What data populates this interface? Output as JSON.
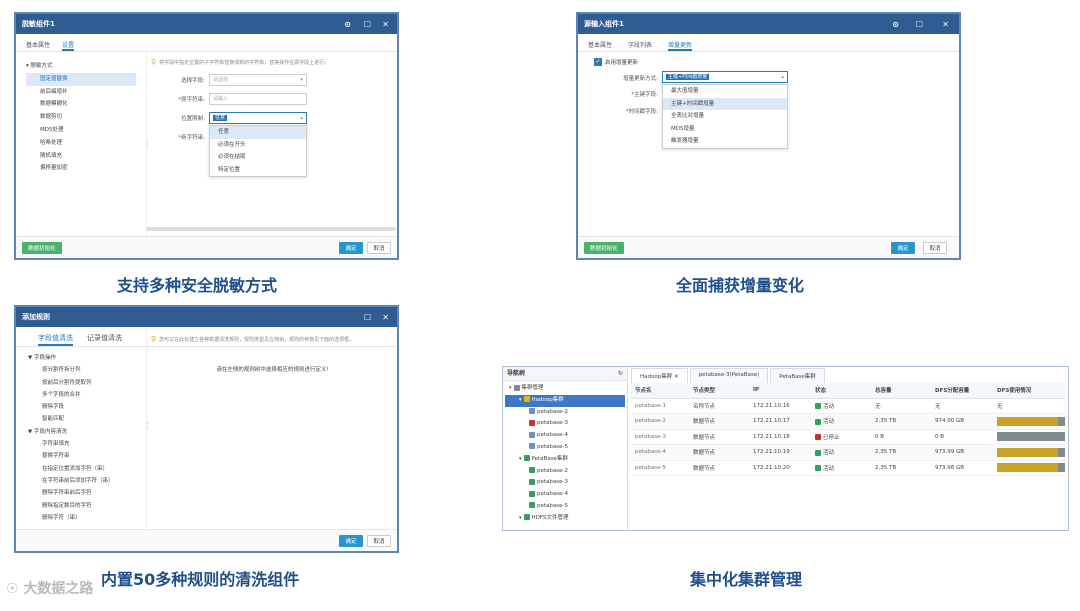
{
  "panel1": {
    "title": "脱敏组件1",
    "tabs": [
      "基本属性",
      "设置"
    ],
    "active_tab": 1,
    "tree_root": "脱敏方式",
    "tree_items": [
      "固定值替换",
      "前后缀增补",
      "数据模糊化",
      "数据剪切",
      "MD5处理",
      "哈希处理",
      "随机填充",
      "偏移量加密"
    ],
    "selected_index": 0,
    "tip": "将字段中指定位置的子字符串替换成新的字符串，替换操作在源字段上进行。",
    "fields": [
      {
        "label": "选择字段:",
        "placeholder": "请选择"
      },
      {
        "label": "*原字符串:",
        "placeholder": "请输入"
      },
      {
        "label": "位置限制:",
        "value": "任意"
      },
      {
        "label": "*新字符串:",
        "placeholder": ""
      }
    ],
    "dropdown": [
      "任意",
      "必须在开头",
      "必须在结尾",
      "特定位置"
    ],
    "green_btn": "数据初始化",
    "ok": "确定",
    "cancel": "取消"
  },
  "panel2": {
    "title": "源输入组件1",
    "tabs": [
      "基本属性",
      "字段列表",
      "增量更新"
    ],
    "active_tab": 2,
    "checkbox_label": "启用增量更新",
    "mode_label": "增量更新方式:",
    "mode_value": "主键+时间戳增量",
    "pk_label": "*主键字段:",
    "ts_label": "*时间戳字段:",
    "dropdown": [
      "最大值增量",
      "主键+时间戳增量",
      "全表比对增量",
      "MD5增量",
      "触发器增量"
    ],
    "dropdown_hl": 1,
    "green_btn": "数据初始化",
    "ok": "确定",
    "cancel": "取消"
  },
  "panel3": {
    "title": "添加规则",
    "tabs": [
      "字段值清洗",
      "记录值清洗"
    ],
    "active_tab": 0,
    "tip": "您可以在此处建立各种数据清洗规则，规则类型见左侧树，规则的参数见下面的选项框。",
    "center_msg": "请在左侧的规则树中选择相应的规则进行定义!",
    "tree": [
      {
        "text": "▼ 字段操作",
        "indent": 0
      },
      {
        "text": "按分割符拆分列",
        "indent": 1
      },
      {
        "text": "按前后分割符提取列",
        "indent": 1
      },
      {
        "text": "多个字段的合并",
        "indent": 1
      },
      {
        "text": "删除字段",
        "indent": 1
      },
      {
        "text": "智能匹配",
        "indent": 1
      },
      {
        "text": "▼ 字段内容清洗",
        "indent": 0
      },
      {
        "text": "字符串填充",
        "indent": 1
      },
      {
        "text": "替换字符串",
        "indent": 1
      },
      {
        "text": "在指定位置添加字符（串）",
        "indent": 1
      },
      {
        "text": "在字符串前后添加字符（串）",
        "indent": 1
      },
      {
        "text": "删除字符串前后字符",
        "indent": 1
      },
      {
        "text": "删除指定数目的字符",
        "indent": 1
      },
      {
        "text": "删除字符（串）",
        "indent": 1
      }
    ],
    "ok": "确定",
    "cancel": "取消"
  },
  "panel4": {
    "nav_title": "导航树",
    "tree": [
      {
        "text": "集群管理",
        "indent": 0,
        "icon": "cluster-icon"
      },
      {
        "text": "Hadoop集群",
        "indent": 1,
        "icon": "hadoop-icon",
        "selected": true
      },
      {
        "text": "petabase-2",
        "indent": 2,
        "icon": "node-icon"
      },
      {
        "text": "petabase-3",
        "indent": 2,
        "icon": "node-stop-icon"
      },
      {
        "text": "petabase-4",
        "indent": 2,
        "icon": "node-icon"
      },
      {
        "text": "petabase-5",
        "indent": 2,
        "icon": "node-icon"
      },
      {
        "text": "PetaBase集群",
        "indent": 1,
        "icon": "petabase-icon"
      },
      {
        "text": "petabase-2",
        "indent": 2,
        "icon": "node-green-icon"
      },
      {
        "text": "petabase-3",
        "indent": 2,
        "icon": "node-green-icon"
      },
      {
        "text": "petabase-4",
        "indent": 2,
        "icon": "node-green-icon"
      },
      {
        "text": "petabase-5",
        "indent": 2,
        "icon": "node-green-icon"
      },
      {
        "text": "HDFS文件管理",
        "indent": 1,
        "icon": "hdfs-icon"
      }
    ],
    "tabs": [
      "Hadoop集群 ✕",
      "petabase-3(PetaBase)",
      "PetaBase集群"
    ],
    "columns": [
      "节点名",
      "节点类型",
      "IP",
      "状态",
      "总容量",
      "DFS分配容量",
      "DFS使用情况"
    ],
    "rows": [
      {
        "name": "petabase-1",
        "type": "名称节点",
        "ip": "172.21.10.16",
        "status": "活动",
        "total": "无",
        "dfs": "无",
        "usage_text": "无",
        "usage": null
      },
      {
        "name": "petabase-2",
        "type": "数据节点",
        "ip": "172.21.10.17",
        "status": "活动",
        "total": "2.35 TB",
        "dfs": "974.00 GB",
        "usage_text": "",
        "usage": 0.9
      },
      {
        "name": "petabase-3",
        "type": "数据节点",
        "ip": "172.21.10.18",
        "status": "已停止",
        "total": "0 B",
        "dfs": "0 B",
        "usage_text": "",
        "usage": 0.0
      },
      {
        "name": "petabase-4",
        "type": "数据节点",
        "ip": "172.21.10.19",
        "status": "活动",
        "total": "2.35 TB",
        "dfs": "973.99 GB",
        "usage_text": "",
        "usage": 0.9
      },
      {
        "name": "petabase-5",
        "type": "数据节点",
        "ip": "172.21.10.20",
        "status": "活动",
        "total": "2.35 TB",
        "dfs": "973.98 GB",
        "usage_text": "",
        "usage": 0.9
      }
    ]
  },
  "captions": {
    "c1": "支持多种安全脱敏方式",
    "c2": "全面捕获增量变化",
    "c3": "内置50多种规则的清洗组件",
    "c4": "集中化集群管理"
  },
  "logo": "大数据之路"
}
